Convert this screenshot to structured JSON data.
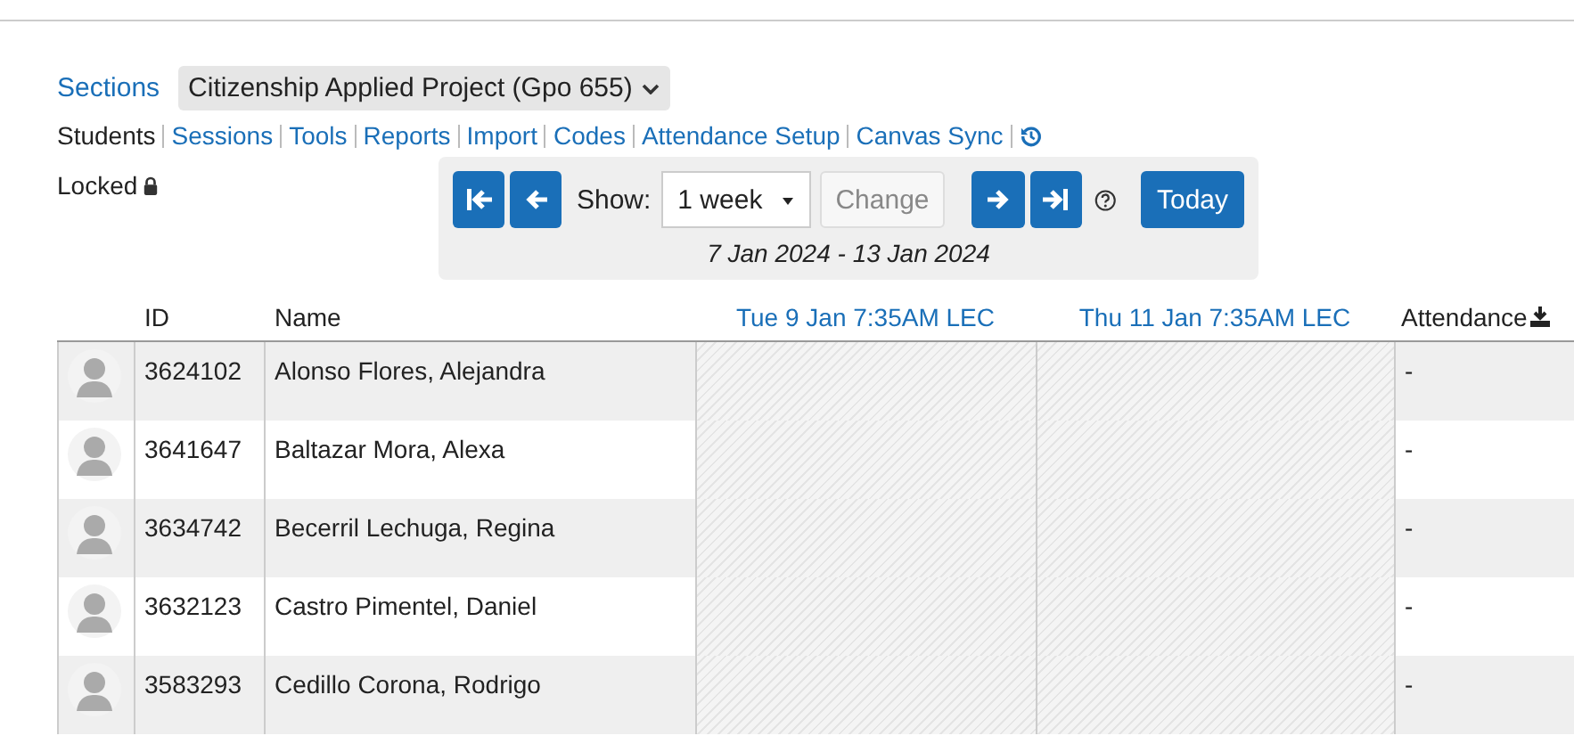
{
  "sections": {
    "label": "Sections",
    "value": "Citizenship Applied Project (Gpo 655)"
  },
  "nav": [
    {
      "label": "Students",
      "selected": true
    },
    {
      "label": "Sessions",
      "selected": false
    },
    {
      "label": "Tools",
      "selected": false
    },
    {
      "label": "Reports",
      "selected": false
    },
    {
      "label": "Import",
      "selected": false
    },
    {
      "label": "Codes",
      "selected": false
    },
    {
      "label": "Attendance Setup",
      "selected": false
    },
    {
      "label": "Canvas Sync",
      "selected": false
    }
  ],
  "lock": {
    "label": "Locked"
  },
  "range": {
    "show_label": "Show:",
    "period": "1 week",
    "change": "Change",
    "change_disabled": true,
    "today": "Today",
    "dates": "7 Jan 2024 - 13 Jan 2024"
  },
  "table": {
    "columns": [
      "ID",
      "Name"
    ],
    "sessions": [
      "Tue 9 Jan 7:35AM LEC",
      "Thu 11 Jan 7:35AM LEC"
    ],
    "last_column": "Attendance",
    "rows": [
      {
        "id": "3624102",
        "name": "Alonso Flores, Alejandra",
        "attendance": "-"
      },
      {
        "id": "3641647",
        "name": "Baltazar Mora, Alexa",
        "attendance": "-"
      },
      {
        "id": "3634742",
        "name": "Becerril Lechuga, Regina",
        "attendance": "-"
      },
      {
        "id": "3632123",
        "name": "Castro Pimentel, Daniel",
        "attendance": "-"
      },
      {
        "id": "3583293",
        "name": "Cedillo Corona, Rodrigo",
        "attendance": "-"
      }
    ]
  }
}
